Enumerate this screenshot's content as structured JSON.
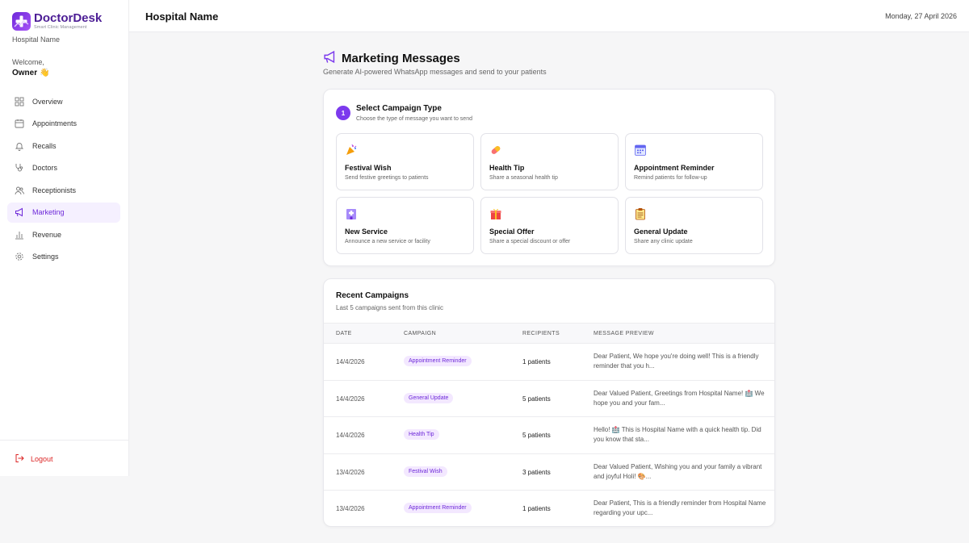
{
  "brand": {
    "name": "DoctorDesk",
    "tagline": "Smart Clinic Management",
    "accent": "#7c3aed"
  },
  "sidebar": {
    "hospital": "Hospital Name",
    "welcome": "Welcome,",
    "user": "Owner",
    "user_emoji": "👋",
    "items": [
      {
        "label": "Overview",
        "icon": "grid-icon"
      },
      {
        "label": "Appointments",
        "icon": "calendar-icon"
      },
      {
        "label": "Recalls",
        "icon": "bell-icon"
      },
      {
        "label": "Doctors",
        "icon": "stethoscope-icon"
      },
      {
        "label": "Receptionists",
        "icon": "users-icon"
      },
      {
        "label": "Marketing",
        "icon": "megaphone-icon",
        "active": true
      },
      {
        "label": "Revenue",
        "icon": "bar-chart-icon"
      },
      {
        "label": "Settings",
        "icon": "gear-icon"
      }
    ],
    "logout": "Logout"
  },
  "header": {
    "title": "Hospital Name",
    "date": "Monday, 27 April 2026"
  },
  "page": {
    "title": "Marketing Messages",
    "subtitle": "Generate AI-powered WhatsApp messages and send to your patients"
  },
  "campaign_type": {
    "step": "1",
    "title": "Select Campaign Type",
    "subtitle": "Choose the type of message you want to send",
    "types": [
      {
        "name": "Festival Wish",
        "desc": "Send festive greetings to patients",
        "icon": "party-popper-icon"
      },
      {
        "name": "Health Tip",
        "desc": "Share a seasonal health tip",
        "icon": "pill-icon"
      },
      {
        "name": "Appointment Reminder",
        "desc": "Remind patients for follow-up",
        "icon": "calendar-icon"
      },
      {
        "name": "New Service",
        "desc": "Announce a new service or facility",
        "icon": "hospital-icon"
      },
      {
        "name": "Special Offer",
        "desc": "Share a special discount or offer",
        "icon": "gift-icon"
      },
      {
        "name": "General Update",
        "desc": "Share any clinic update",
        "icon": "clipboard-icon"
      }
    ]
  },
  "recent": {
    "title": "Recent Campaigns",
    "subtitle": "Last 5 campaigns sent from this clinic",
    "columns": [
      "DATE",
      "CAMPAIGN",
      "RECIPIENTS",
      "MESSAGE PREVIEW"
    ],
    "rows": [
      {
        "date": "14/4/2026",
        "campaign": "Appointment Reminder",
        "recipients": "1 patients",
        "preview": "Dear Patient, We hope you're doing well! This is a friendly reminder that you h..."
      },
      {
        "date": "14/4/2026",
        "campaign": "General Update",
        "recipients": "5 patients",
        "preview": "Dear Valued Patient, Greetings from Hospital Name! 🏥 We hope you and your fam..."
      },
      {
        "date": "14/4/2026",
        "campaign": "Health Tip",
        "recipients": "5 patients",
        "preview": "Hello! 🏥 This is Hospital Name with a quick health tip. Did you know that sta..."
      },
      {
        "date": "13/4/2026",
        "campaign": "Festival Wish",
        "recipients": "3 patients",
        "preview": "Dear Valued Patient, Wishing you and your family a vibrant and joyful Holi! 🎨..."
      },
      {
        "date": "13/4/2026",
        "campaign": "Appointment Reminder",
        "recipients": "1 patients",
        "preview": "Dear Patient, This is a friendly reminder from Hospital Name regarding your upc..."
      }
    ]
  }
}
